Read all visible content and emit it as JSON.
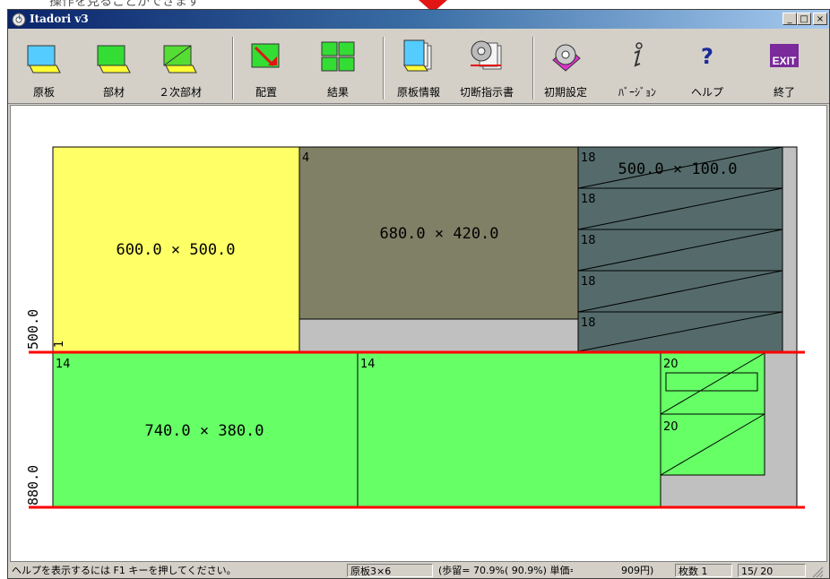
{
  "top_hint": "操作を見ることができます",
  "window": {
    "title": "Itadori v3",
    "min_glyph": "_",
    "max_glyph": "□",
    "close_glyph": "×"
  },
  "toolbar": [
    {
      "label": "原板",
      "icon": "board-icon"
    },
    {
      "label": "部材",
      "icon": "parts-icon"
    },
    {
      "label": "２次部材",
      "icon": "secondary-parts-icon"
    },
    {
      "label": "配置",
      "icon": "placement-icon"
    },
    {
      "label": "結果",
      "icon": "results-icon"
    },
    {
      "label": "原板情報",
      "icon": "board-info-icon"
    },
    {
      "label": "切断指示書",
      "icon": "cutting-instructions-icon"
    },
    {
      "label": "初期設定",
      "icon": "initial-settings-icon"
    },
    {
      "label": "ﾊﾞｰｼﾞｮﾝ",
      "icon": "version-info-icon"
    },
    {
      "label": "ヘルプ",
      "icon": "help-icon"
    },
    {
      "label": "終了",
      "icon": "exit-icon",
      "badge": "EXIT"
    }
  ],
  "layout": {
    "part_yellow": {
      "label": "600.0 × 500.0",
      "color": "#ffff66"
    },
    "part_olive": {
      "label": "680.0 × 420.0",
      "tag": "4",
      "color": "#808066"
    },
    "part_teal": {
      "label": "500.0 × 100.0",
      "tags": [
        "18",
        "18",
        "18",
        "18",
        "18"
      ],
      "color": "#556b6b"
    },
    "part_green_left": {
      "label": "740.0 × 380.0",
      "tag": "14",
      "color": "#66ff66"
    },
    "part_green_right": {
      "tag": "14",
      "color": "#66ff66"
    },
    "part_small_top": {
      "tag": "20"
    },
    "part_small_bottom": {
      "tag": "20"
    },
    "left_row_marker": "1",
    "dim_top": "500.0",
    "dim_bottom": "880.0",
    "cut_line_color": "#ff0000"
  },
  "status": {
    "help_text": "ヘルプを表示するには F1 キーを押してください。",
    "board_size": "原板3×6",
    "yield_text": "(歩留= 70.9%( 90.9%) 単価=",
    "price": "909円)",
    "count_label": "枚数 1",
    "page": "15/  20"
  }
}
